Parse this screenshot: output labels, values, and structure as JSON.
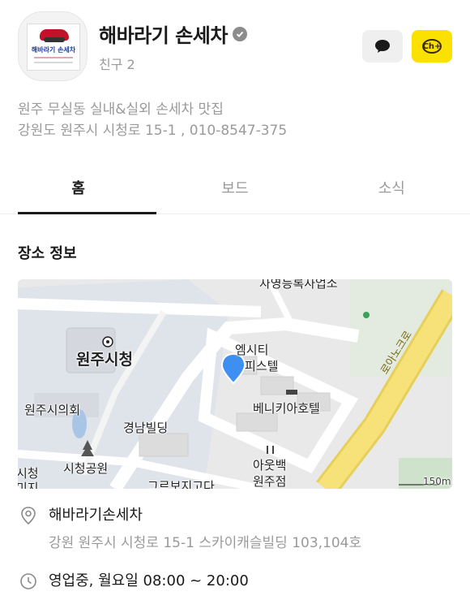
{
  "channel": {
    "name": "해바라기 손세차",
    "friends": "친구 2",
    "logo_text": "해바라기 손세차",
    "verified_icon": "check-badge-icon",
    "chat_icon": "speech-bubble-icon",
    "channel_add_label": "Ch+"
  },
  "description": {
    "line1": "원주 무실동 실내&실외 손세차 맛집",
    "line2": "강원도 원주시 시청로 15-1 , 010-8547-375"
  },
  "tabs": [
    {
      "label": "홈"
    },
    {
      "label": "보드"
    },
    {
      "label": "소식"
    }
  ],
  "place": {
    "section_title": "장소 정보",
    "map_labels": {
      "top": "자영등록사업소",
      "city_hall": "원주시청",
      "city_council": "원주시의회",
      "park": "시청공원",
      "gyeongnam": "경남빌딩",
      "mcity_1": "엠시티",
      "mcity_2": "피스텔",
      "venikia": "베니키아호텔",
      "outback_1": "아웃백",
      "outback_2": "원주점",
      "road": "로아노크로",
      "scale": "150m",
      "partial_left_1": "시청",
      "partial_left_2": "미지",
      "bottom": "그르보지고다"
    },
    "name": "해바라기손세차",
    "address": "강원 원주시 시청로 15-1 스카이캐슬빌딩 103,104호",
    "hours": "영업중, 월요일 08:00 ~ 20:00",
    "location_icon": "map-pin-icon",
    "clock_icon": "clock-icon",
    "colors": {
      "map_road_main": "#f7e27a",
      "map_pin": "#3d8ff2",
      "ch_button": "#fae100"
    }
  }
}
